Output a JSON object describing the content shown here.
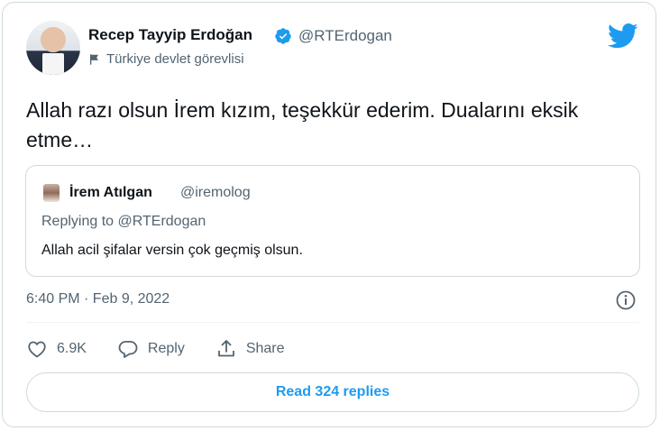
{
  "author": {
    "name": "Recep Tayyip Erdoğan",
    "handle": "@RTErdogan",
    "label": "Türkiye devlet görevlisi"
  },
  "tweet": {
    "text": "Allah razı olsun İrem kızım, teşekkür ederim. Dualarını eksik etme…",
    "timestamp": "6:40 PM · Feb 9, 2022"
  },
  "quoted": {
    "name": "İrem Atılgan",
    "handle": "@iremolog",
    "replying_to": "Replying to @RTErdogan",
    "text": "Allah acil şifalar versin çok geçmiş olsun."
  },
  "actions": {
    "likes": "6.9K",
    "reply_label": "Reply",
    "share_label": "Share"
  },
  "read_replies_label": "Read 324 replies",
  "colors": {
    "accent": "#1d9bf0",
    "secondary_text": "#536471",
    "border": "#cfd9de"
  },
  "icons": [
    "verified-badge-icon",
    "flag-icon",
    "twitter-bird-icon",
    "info-icon",
    "heart-icon",
    "reply-bubble-icon",
    "share-icon"
  ]
}
